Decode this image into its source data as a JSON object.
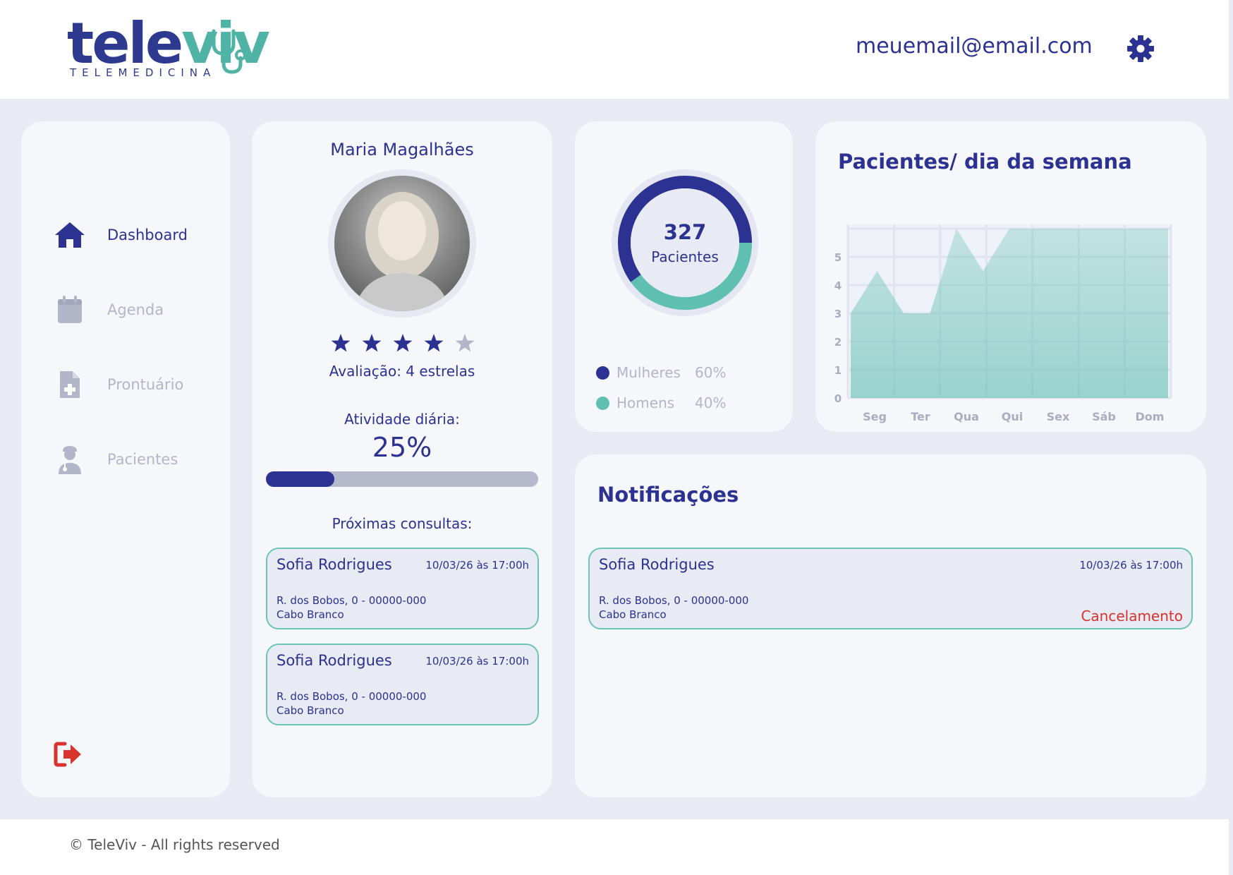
{
  "header": {
    "logo_primary": "tele",
    "logo_accent": "viv",
    "logo_subtitle": "TELEMEDICINA",
    "email": "meuemail@email.com",
    "settings_icon": "gear-icon"
  },
  "sidebar": {
    "items": [
      {
        "label": "Dashboard",
        "icon": "home-icon",
        "active": true
      },
      {
        "label": "Agenda",
        "icon": "calendar-icon",
        "active": false
      },
      {
        "label": "Prontuário",
        "icon": "medical-record-icon",
        "active": false
      },
      {
        "label": "Pacientes",
        "icon": "doctor-icon",
        "active": false
      }
    ],
    "logout_icon": "logout-icon"
  },
  "profile": {
    "name": "Maria Magalhães",
    "rating": 4,
    "rating_max": 5,
    "rating_text": "Avaliação: 4 estrelas",
    "activity_label": "Atividade diária:",
    "activity_value": "25%",
    "activity_fraction": 0.25,
    "next_label": "Próximas consultas:",
    "appointments": [
      {
        "name": "Sofia Rodrigues",
        "date": "10/03/26 às 17:00h",
        "address": "R. dos Bobos, 0 - 00000-000",
        "city": "Cabo Branco"
      },
      {
        "name": "Sofia Rodrigues",
        "date": "10/03/26 às 17:00h",
        "address": "R. dos Bobos, 0 - 00000-000",
        "city": "Cabo Branco"
      }
    ]
  },
  "patients": {
    "total": "327",
    "total_label": "Pacientes",
    "legend": [
      {
        "label": "Mulheres",
        "percent": "60%",
        "value": 60,
        "color": "#2b3291"
      },
      {
        "label": "Homens",
        "percent": "40%",
        "value": 40,
        "color": "#5fbfb1"
      }
    ]
  },
  "chart_data": {
    "type": "area",
    "title": "Pacientes/ dia da semana",
    "categories": [
      "Seg",
      "Ter",
      "Qua",
      "Qui",
      "Sex",
      "Sáb",
      "Dom"
    ],
    "yticks": [
      0,
      1,
      2,
      3,
      4,
      5
    ],
    "ylim": [
      0,
      6
    ],
    "x": [
      0,
      0.5,
      1,
      1.5,
      2,
      2.5,
      3,
      3.5,
      4,
      4.5,
      5,
      5.5,
      6
    ],
    "values": [
      3,
      4.5,
      3,
      3,
      6,
      4.5,
      6,
      6,
      6,
      6,
      6,
      6,
      6
    ],
    "grid": true,
    "legend": "none",
    "color": "#5fbfb1"
  },
  "notifications": {
    "title": "Notificações",
    "items": [
      {
        "name": "Sofia Rodrigues",
        "date": "10/03/26 às 17:00h",
        "address": "R. dos Bobos, 0 - 00000-000",
        "city": "Cabo Branco",
        "status": "Cancelamento"
      }
    ]
  },
  "footer": {
    "text": "© TeleViv - All rights reserved"
  }
}
